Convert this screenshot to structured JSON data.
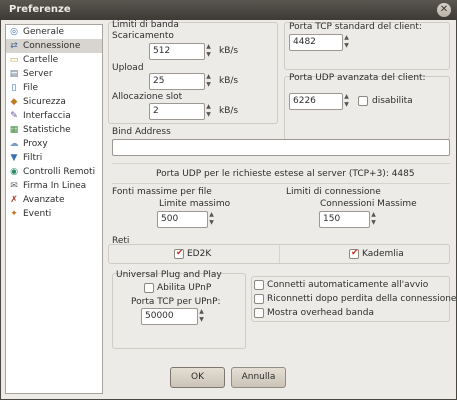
{
  "window": {
    "title": "Preferenze",
    "close_glyph": "✕"
  },
  "sidebar": {
    "items": [
      {
        "label": "Generale",
        "icon": "globe-icon",
        "glyph": "◎"
      },
      {
        "label": "Connessione",
        "icon": "connection-icon",
        "glyph": "⇄",
        "selected": true
      },
      {
        "label": "Cartelle",
        "icon": "folder-icon",
        "glyph": "▭"
      },
      {
        "label": "Server",
        "icon": "server-icon",
        "glyph": "▤"
      },
      {
        "label": "File",
        "icon": "file-icon",
        "glyph": "▯"
      },
      {
        "label": "Sicurezza",
        "icon": "security-icon",
        "glyph": "◆"
      },
      {
        "label": "Interfaccia",
        "icon": "interface-icon",
        "glyph": "✎"
      },
      {
        "label": "Statistiche",
        "icon": "statistics-icon",
        "glyph": "▦"
      },
      {
        "label": "Proxy",
        "icon": "proxy-icon",
        "glyph": "☁"
      },
      {
        "label": "Filtri",
        "icon": "filter-icon",
        "glyph": "▼"
      },
      {
        "label": "Controlli Remoti",
        "icon": "remote-control-icon",
        "glyph": "◉"
      },
      {
        "label": "Firma In Linea",
        "icon": "signature-icon",
        "glyph": "✉"
      },
      {
        "label": "Avanzate",
        "icon": "advanced-icon",
        "glyph": "✗"
      },
      {
        "label": "Eventi",
        "icon": "events-icon",
        "glyph": "✦"
      }
    ]
  },
  "bandwidth": {
    "title": "Limiti di banda",
    "download_label": "Scaricamento",
    "download_value": "512",
    "download_unit": "kB/s",
    "upload_label": "Upload",
    "upload_value": "25",
    "upload_unit": "kB/s",
    "slot_label": "Allocazione slot",
    "slot_value": "2",
    "slot_unit": "kB/s"
  },
  "tcp_port": {
    "label": "Porta TCP standard del client:",
    "value": "4482"
  },
  "udp_port": {
    "label": "Porta UDP avanzata del client:",
    "value": "6226",
    "disable_label": "disabilita",
    "disabled": false
  },
  "bind": {
    "label": "Bind Address",
    "value": ""
  },
  "udp_extended_note": "Porta UDP per le richieste estese al server (TCP+3): 4485",
  "max_sources": {
    "title": "Fonti massime per file",
    "label": "Limite massimo",
    "value": "500"
  },
  "conn_limits": {
    "title": "Limiti di connessione",
    "label": "Connessioni Massime",
    "value": "150"
  },
  "networks": {
    "title": "Reti",
    "ed2k_label": "ED2K",
    "ed2k_checked": true,
    "kad_label": "Kademlia",
    "kad_checked": true
  },
  "upnp": {
    "title": "Universal Plug and Play",
    "enable_label": "Abilita UPnP",
    "enabled": false,
    "port_label": "Porta TCP per UPnP:",
    "port_value": "50000"
  },
  "options": {
    "autoconnect_label": "Connetti automaticamente all'avvio",
    "reconnect_label": "Riconnetti dopo perdita della connessione",
    "overhead_label": "Mostra overhead banda"
  },
  "buttons": {
    "ok": "OK",
    "cancel": "Annulla"
  }
}
